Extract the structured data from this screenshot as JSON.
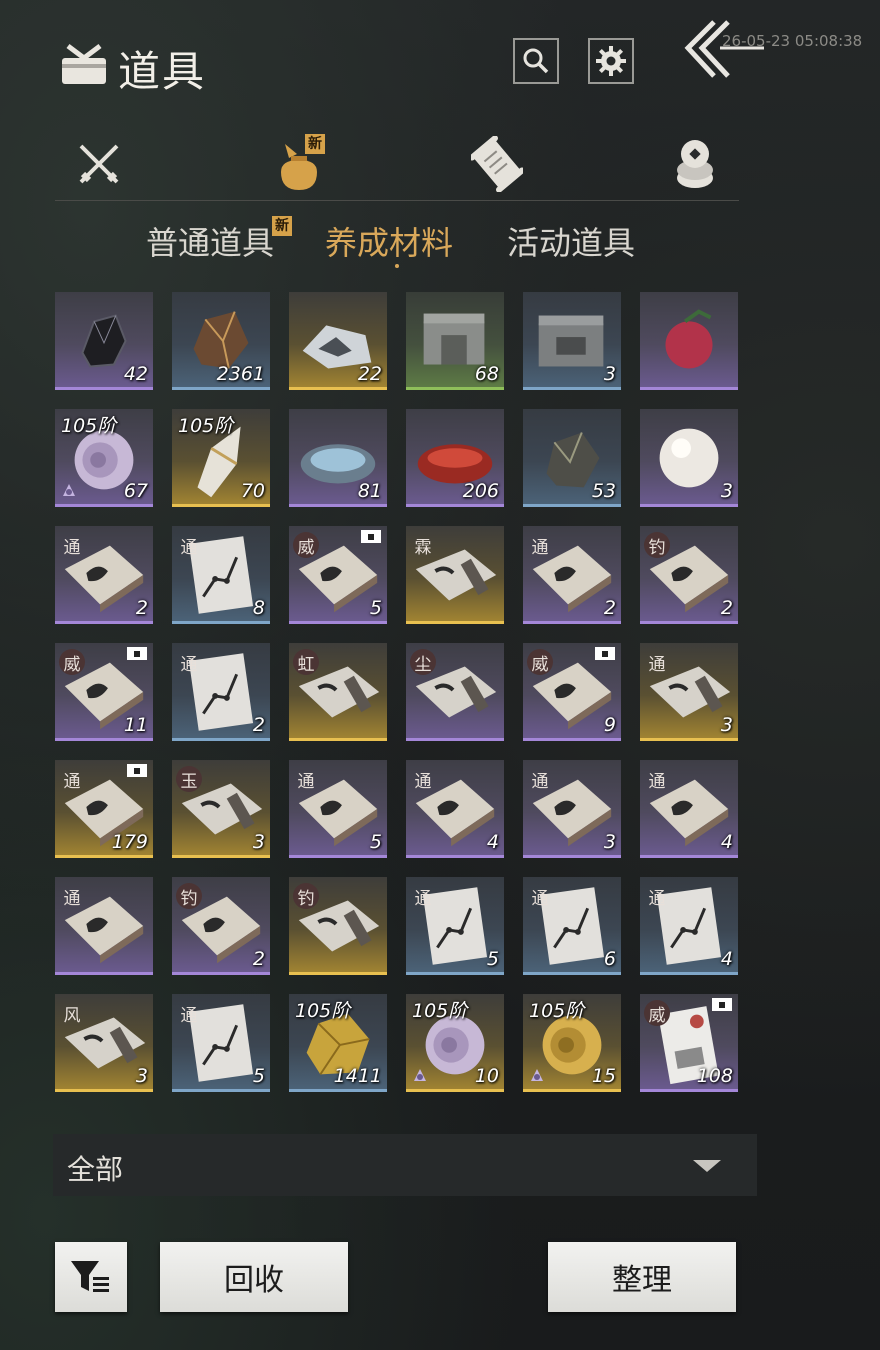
{
  "header": {
    "title": "道具",
    "timestamp": "26-05-23 05:08:38",
    "search_icon": "search-icon",
    "settings_icon": "gear-icon",
    "back_icon": "double-chevron-left-icon"
  },
  "category_tabs": [
    {
      "icon": "crossed-swords-icon",
      "new": false
    },
    {
      "icon": "pouch-icon",
      "new": true,
      "new_label": "新",
      "active": true
    },
    {
      "icon": "scroll-icon",
      "new": false
    },
    {
      "icon": "stacked-coins-icon",
      "new": false
    }
  ],
  "sub_tabs": [
    {
      "label": "普通道具",
      "new": true,
      "new_label": "新"
    },
    {
      "label": "养成材料",
      "active": true
    },
    {
      "label": "活动道具"
    }
  ],
  "items": [
    {
      "rarity": "purple",
      "art": "ore",
      "count": "42"
    },
    {
      "rarity": "blue",
      "art": "copper-ore",
      "count": "2361"
    },
    {
      "rarity": "gold",
      "art": "map",
      "count": "22"
    },
    {
      "rarity": "green",
      "art": "stone-block",
      "count": "68"
    },
    {
      "rarity": "blue",
      "art": "carved-stone",
      "count": "3"
    },
    {
      "rarity": "purple",
      "art": "fruit",
      "count": ""
    },
    {
      "rarity": "purple",
      "art": "shell",
      "count": "67",
      "tier": "105阶",
      "bound": true
    },
    {
      "rarity": "gold",
      "art": "crystal",
      "count": "70",
      "tier": "105阶"
    },
    {
      "rarity": "purple",
      "art": "dish",
      "count": "81"
    },
    {
      "rarity": "purple",
      "art": "red-dish",
      "count": "206"
    },
    {
      "rarity": "blue",
      "art": "rock",
      "count": "53"
    },
    {
      "rarity": "purple",
      "art": "pearl",
      "count": "3"
    },
    {
      "rarity": "purple",
      "art": "book",
      "count": "2",
      "tag": "通"
    },
    {
      "rarity": "blue",
      "art": "chart",
      "count": "8",
      "tag": "通"
    },
    {
      "rarity": "purple",
      "art": "book",
      "count": "5",
      "tag": "威",
      "tagged": true,
      "badge": true
    },
    {
      "rarity": "gold",
      "art": "scroll",
      "count": "",
      "tag": "霖"
    },
    {
      "rarity": "purple",
      "art": "book",
      "count": "2",
      "tag": "通"
    },
    {
      "rarity": "purple",
      "art": "book",
      "count": "2",
      "tag": "钓",
      "tagged": true
    },
    {
      "rarity": "purple",
      "art": "book",
      "count": "11",
      "tag": "威",
      "tagged": true,
      "badge": true
    },
    {
      "rarity": "blue",
      "art": "chart",
      "count": "2",
      "tag": "通"
    },
    {
      "rarity": "gold",
      "art": "scroll",
      "count": "",
      "tag": "虹",
      "tagged": true
    },
    {
      "rarity": "purple",
      "art": "scroll",
      "count": "",
      "tag": "尘",
      "tagged": true
    },
    {
      "rarity": "purple",
      "art": "book",
      "count": "9",
      "tag": "威",
      "tagged": true,
      "badge": true
    },
    {
      "rarity": "gold",
      "art": "scroll",
      "count": "3",
      "tag": "通"
    },
    {
      "rarity": "gold",
      "art": "book",
      "count": "179",
      "tag": "通",
      "badge": true
    },
    {
      "rarity": "gold",
      "art": "scroll",
      "count": "3",
      "tag": "玉",
      "tagged": true
    },
    {
      "rarity": "purple",
      "art": "book",
      "count": "5",
      "tag": "通"
    },
    {
      "rarity": "purple",
      "art": "book",
      "count": "4",
      "tag": "通"
    },
    {
      "rarity": "purple",
      "art": "book",
      "count": "3",
      "tag": "通"
    },
    {
      "rarity": "purple",
      "art": "book",
      "count": "4",
      "tag": "通"
    },
    {
      "rarity": "purple",
      "art": "book",
      "count": "",
      "tag": "通"
    },
    {
      "rarity": "purple",
      "art": "book",
      "count": "2",
      "tag": "钓",
      "tagged": true
    },
    {
      "rarity": "gold",
      "art": "scroll",
      "count": "",
      "tag": "钓",
      "tagged": true
    },
    {
      "rarity": "blue",
      "art": "chart",
      "count": "5",
      "tag": "通"
    },
    {
      "rarity": "blue",
      "art": "chart",
      "count": "6",
      "tag": "通"
    },
    {
      "rarity": "blue",
      "art": "chart",
      "count": "4",
      "tag": "通"
    },
    {
      "rarity": "gold",
      "art": "scroll",
      "count": "3",
      "tag": "风"
    },
    {
      "rarity": "blue",
      "art": "chart",
      "count": "5",
      "tag": "通"
    },
    {
      "rarity": "blue",
      "art": "gold-nugget",
      "count": "1411",
      "tier": "105阶"
    },
    {
      "rarity": "gold",
      "art": "shell",
      "count": "10",
      "tier": "105阶",
      "bound": true
    },
    {
      "rarity": "gold",
      "art": "gold-shell",
      "count": "15",
      "tier": "105阶",
      "bound": true
    },
    {
      "rarity": "purple",
      "art": "letter",
      "count": "108",
      "tag": "威",
      "tagged": true,
      "badge": true
    }
  ],
  "filter": {
    "label": "全部"
  },
  "buttons": {
    "filter_icon": "filter-icon",
    "recycle_label": "回收",
    "sort_label": "整理"
  },
  "colors": {
    "accent": "#d9a85a",
    "purple": "#a487d8",
    "gold": "#e8c050",
    "blue": "#7fa6c8",
    "green": "#8fbf5a"
  }
}
